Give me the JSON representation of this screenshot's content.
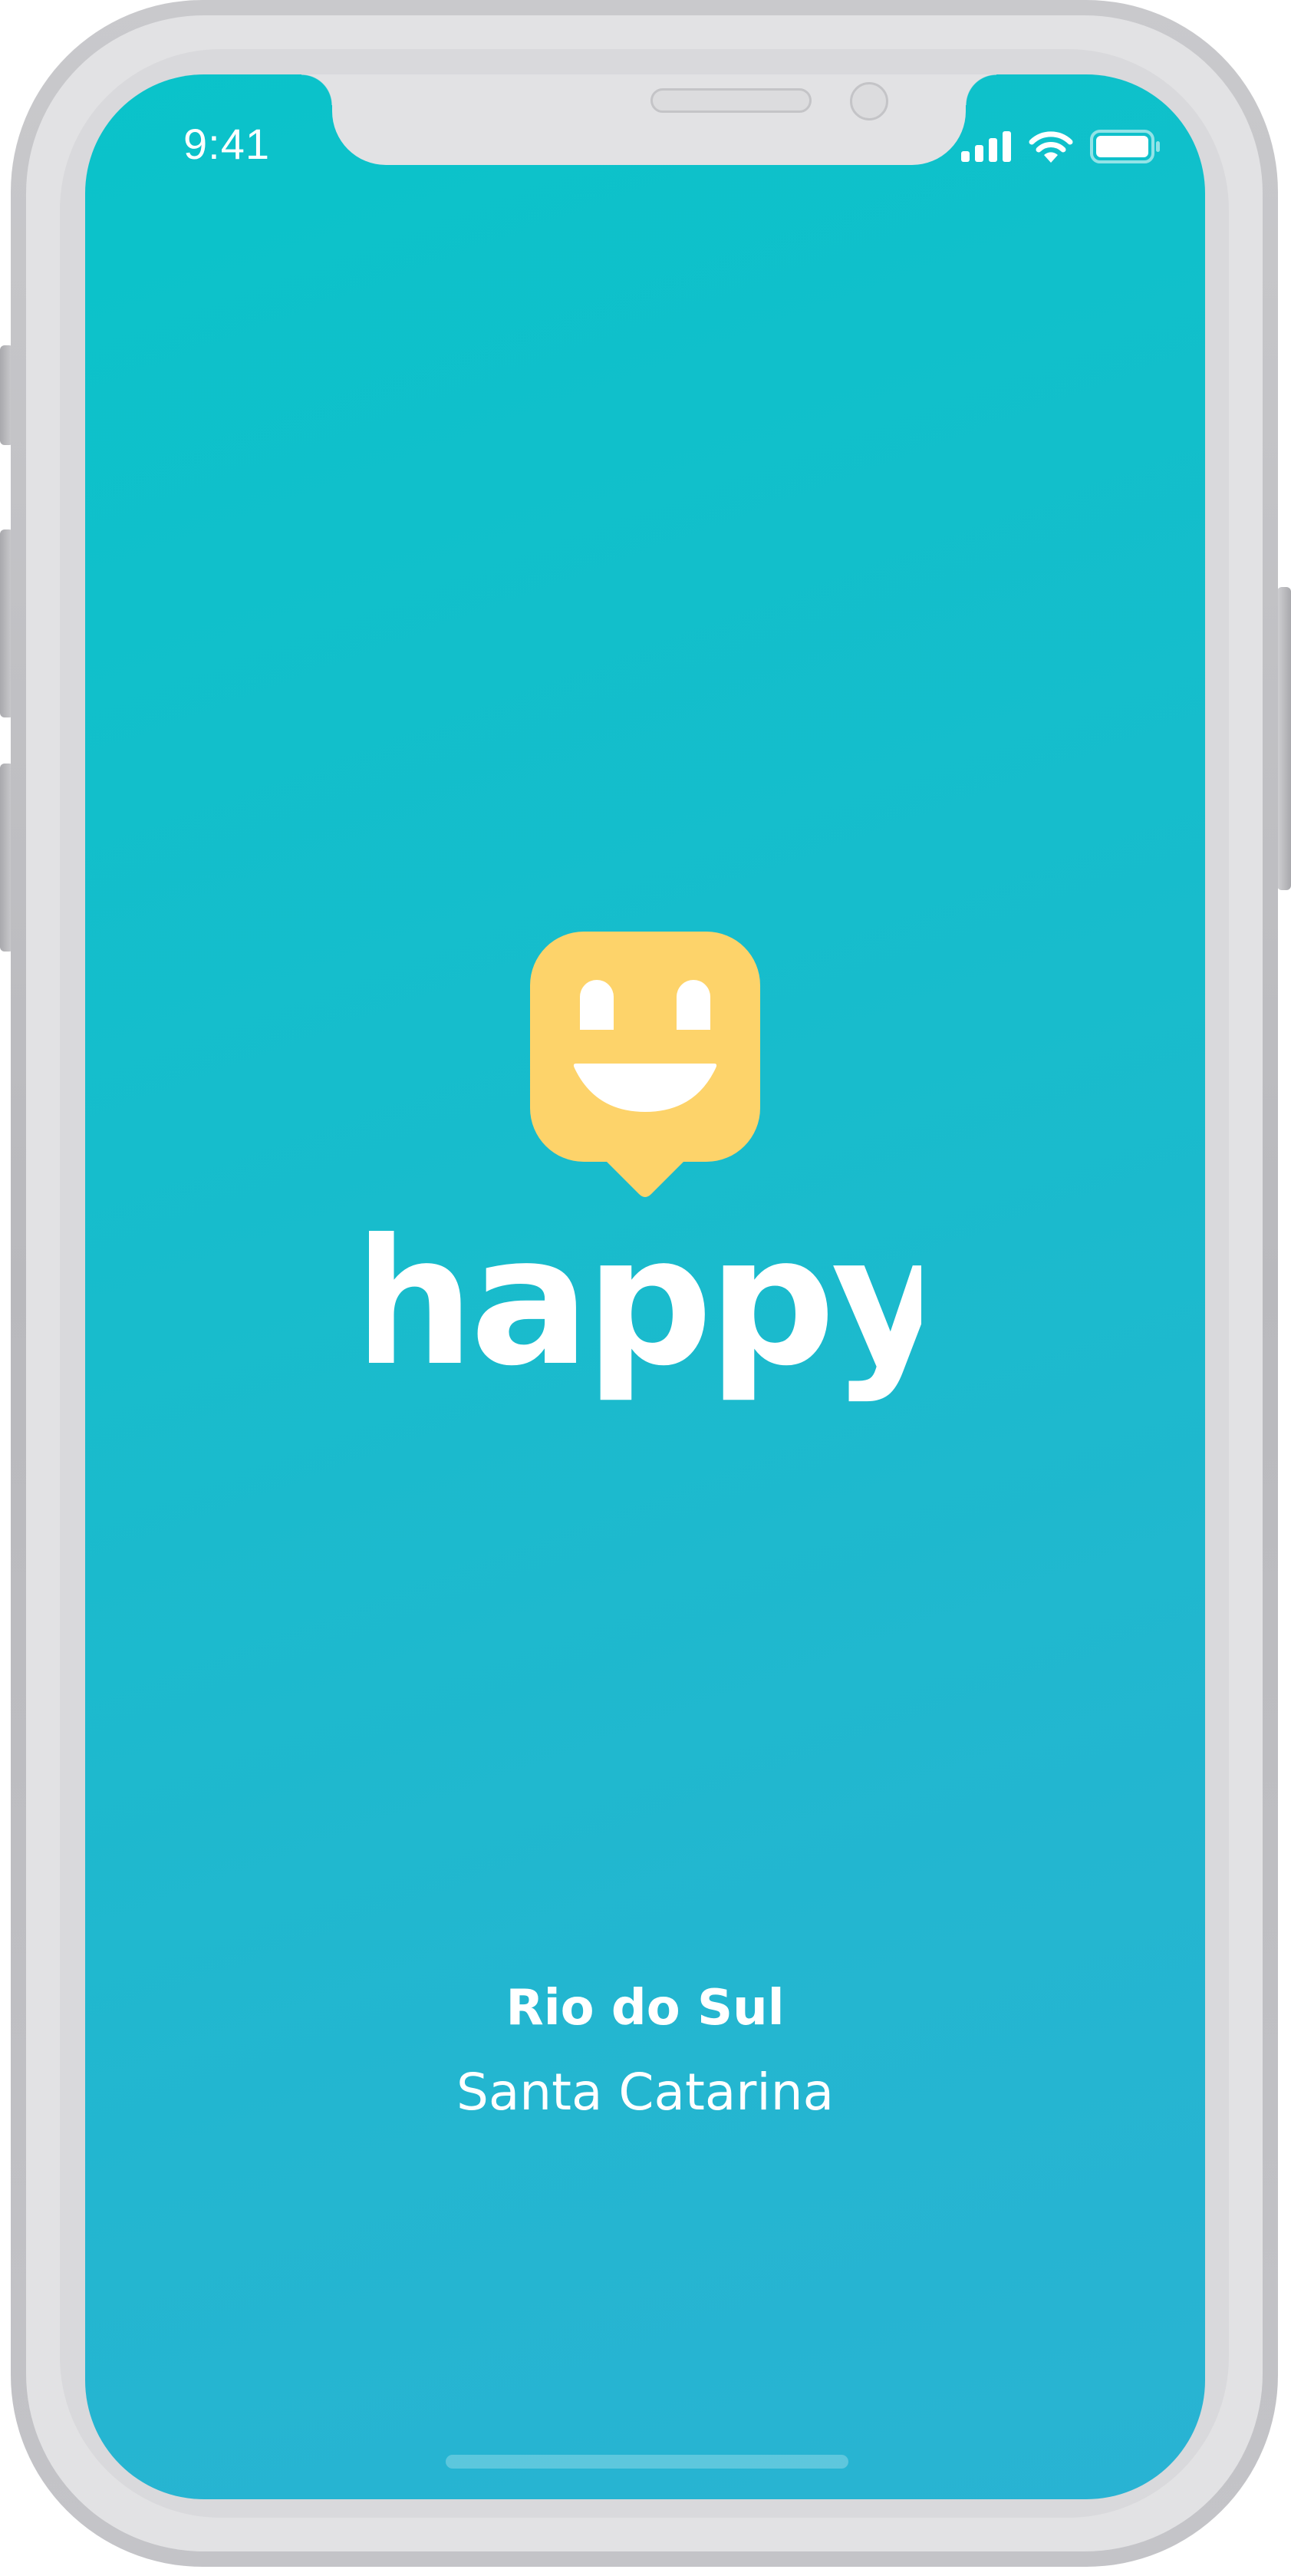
{
  "status_bar": {
    "time": "9:41",
    "icons": [
      "cellular-signal-icon",
      "wifi-icon",
      "battery-icon"
    ]
  },
  "splash": {
    "logo_icon": "smiley-speech-bubble-icon",
    "brand_name": "happy",
    "city": "Rio do Sul",
    "state": "Santa Catarina"
  },
  "colors": {
    "background_top": "#0ac3ca",
    "background_bottom": "#29b3d3",
    "logo_yellow": "#fdd36a",
    "text": "#ffffff"
  }
}
